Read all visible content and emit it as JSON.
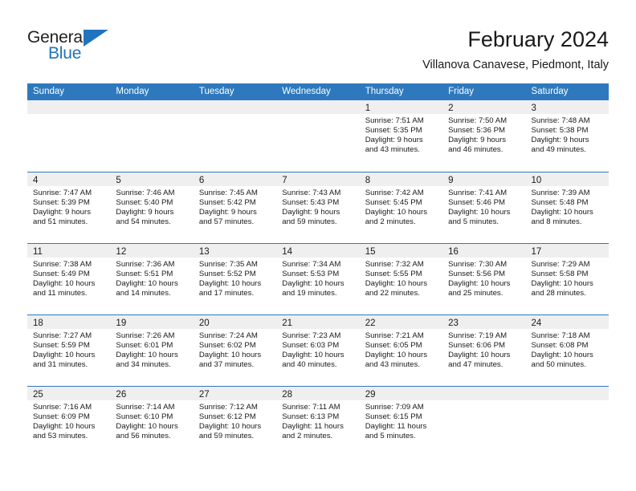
{
  "logo": {
    "word_general": "General",
    "word_blue": "Blue",
    "triangle_color": "#1f74bd"
  },
  "header": {
    "title": "February 2024",
    "subtitle": "Villanova Canavese, Piedmont, Italy"
  },
  "theme": {
    "header_blue": "#2e79bd",
    "strip_gray": "#efefef",
    "text": "#1a1a1a"
  },
  "weekdays": [
    "Sunday",
    "Monday",
    "Tuesday",
    "Wednesday",
    "Thursday",
    "Friday",
    "Saturday"
  ],
  "weeks": [
    [
      {
        "day": "",
        "sunrise": "",
        "sunset": "",
        "daylight1": "",
        "daylight2": "",
        "empty": true
      },
      {
        "day": "",
        "sunrise": "",
        "sunset": "",
        "daylight1": "",
        "daylight2": "",
        "empty": true
      },
      {
        "day": "",
        "sunrise": "",
        "sunset": "",
        "daylight1": "",
        "daylight2": "",
        "empty": true
      },
      {
        "day": "",
        "sunrise": "",
        "sunset": "",
        "daylight1": "",
        "daylight2": "",
        "empty": true
      },
      {
        "day": "1",
        "sunrise": "Sunrise: 7:51 AM",
        "sunset": "Sunset: 5:35 PM",
        "daylight1": "Daylight: 9 hours",
        "daylight2": "and 43 minutes.",
        "empty": false
      },
      {
        "day": "2",
        "sunrise": "Sunrise: 7:50 AM",
        "sunset": "Sunset: 5:36 PM",
        "daylight1": "Daylight: 9 hours",
        "daylight2": "and 46 minutes.",
        "empty": false
      },
      {
        "day": "3",
        "sunrise": "Sunrise: 7:48 AM",
        "sunset": "Sunset: 5:38 PM",
        "daylight1": "Daylight: 9 hours",
        "daylight2": "and 49 minutes.",
        "empty": false
      }
    ],
    [
      {
        "day": "4",
        "sunrise": "Sunrise: 7:47 AM",
        "sunset": "Sunset: 5:39 PM",
        "daylight1": "Daylight: 9 hours",
        "daylight2": "and 51 minutes.",
        "empty": false
      },
      {
        "day": "5",
        "sunrise": "Sunrise: 7:46 AM",
        "sunset": "Sunset: 5:40 PM",
        "daylight1": "Daylight: 9 hours",
        "daylight2": "and 54 minutes.",
        "empty": false
      },
      {
        "day": "6",
        "sunrise": "Sunrise: 7:45 AM",
        "sunset": "Sunset: 5:42 PM",
        "daylight1": "Daylight: 9 hours",
        "daylight2": "and 57 minutes.",
        "empty": false
      },
      {
        "day": "7",
        "sunrise": "Sunrise: 7:43 AM",
        "sunset": "Sunset: 5:43 PM",
        "daylight1": "Daylight: 9 hours",
        "daylight2": "and 59 minutes.",
        "empty": false
      },
      {
        "day": "8",
        "sunrise": "Sunrise: 7:42 AM",
        "sunset": "Sunset: 5:45 PM",
        "daylight1": "Daylight: 10 hours",
        "daylight2": "and 2 minutes.",
        "empty": false
      },
      {
        "day": "9",
        "sunrise": "Sunrise: 7:41 AM",
        "sunset": "Sunset: 5:46 PM",
        "daylight1": "Daylight: 10 hours",
        "daylight2": "and 5 minutes.",
        "empty": false
      },
      {
        "day": "10",
        "sunrise": "Sunrise: 7:39 AM",
        "sunset": "Sunset: 5:48 PM",
        "daylight1": "Daylight: 10 hours",
        "daylight2": "and 8 minutes.",
        "empty": false
      }
    ],
    [
      {
        "day": "11",
        "sunrise": "Sunrise: 7:38 AM",
        "sunset": "Sunset: 5:49 PM",
        "daylight1": "Daylight: 10 hours",
        "daylight2": "and 11 minutes.",
        "empty": false
      },
      {
        "day": "12",
        "sunrise": "Sunrise: 7:36 AM",
        "sunset": "Sunset: 5:51 PM",
        "daylight1": "Daylight: 10 hours",
        "daylight2": "and 14 minutes.",
        "empty": false
      },
      {
        "day": "13",
        "sunrise": "Sunrise: 7:35 AM",
        "sunset": "Sunset: 5:52 PM",
        "daylight1": "Daylight: 10 hours",
        "daylight2": "and 17 minutes.",
        "empty": false
      },
      {
        "day": "14",
        "sunrise": "Sunrise: 7:34 AM",
        "sunset": "Sunset: 5:53 PM",
        "daylight1": "Daylight: 10 hours",
        "daylight2": "and 19 minutes.",
        "empty": false
      },
      {
        "day": "15",
        "sunrise": "Sunrise: 7:32 AM",
        "sunset": "Sunset: 5:55 PM",
        "daylight1": "Daylight: 10 hours",
        "daylight2": "and 22 minutes.",
        "empty": false
      },
      {
        "day": "16",
        "sunrise": "Sunrise: 7:30 AM",
        "sunset": "Sunset: 5:56 PM",
        "daylight1": "Daylight: 10 hours",
        "daylight2": "and 25 minutes.",
        "empty": false
      },
      {
        "day": "17",
        "sunrise": "Sunrise: 7:29 AM",
        "sunset": "Sunset: 5:58 PM",
        "daylight1": "Daylight: 10 hours",
        "daylight2": "and 28 minutes.",
        "empty": false
      }
    ],
    [
      {
        "day": "18",
        "sunrise": "Sunrise: 7:27 AM",
        "sunset": "Sunset: 5:59 PM",
        "daylight1": "Daylight: 10 hours",
        "daylight2": "and 31 minutes.",
        "empty": false
      },
      {
        "day": "19",
        "sunrise": "Sunrise: 7:26 AM",
        "sunset": "Sunset: 6:01 PM",
        "daylight1": "Daylight: 10 hours",
        "daylight2": "and 34 minutes.",
        "empty": false
      },
      {
        "day": "20",
        "sunrise": "Sunrise: 7:24 AM",
        "sunset": "Sunset: 6:02 PM",
        "daylight1": "Daylight: 10 hours",
        "daylight2": "and 37 minutes.",
        "empty": false
      },
      {
        "day": "21",
        "sunrise": "Sunrise: 7:23 AM",
        "sunset": "Sunset: 6:03 PM",
        "daylight1": "Daylight: 10 hours",
        "daylight2": "and 40 minutes.",
        "empty": false
      },
      {
        "day": "22",
        "sunrise": "Sunrise: 7:21 AM",
        "sunset": "Sunset: 6:05 PM",
        "daylight1": "Daylight: 10 hours",
        "daylight2": "and 43 minutes.",
        "empty": false
      },
      {
        "day": "23",
        "sunrise": "Sunrise: 7:19 AM",
        "sunset": "Sunset: 6:06 PM",
        "daylight1": "Daylight: 10 hours",
        "daylight2": "and 47 minutes.",
        "empty": false
      },
      {
        "day": "24",
        "sunrise": "Sunrise: 7:18 AM",
        "sunset": "Sunset: 6:08 PM",
        "daylight1": "Daylight: 10 hours",
        "daylight2": "and 50 minutes.",
        "empty": false
      }
    ],
    [
      {
        "day": "25",
        "sunrise": "Sunrise: 7:16 AM",
        "sunset": "Sunset: 6:09 PM",
        "daylight1": "Daylight: 10 hours",
        "daylight2": "and 53 minutes.",
        "empty": false
      },
      {
        "day": "26",
        "sunrise": "Sunrise: 7:14 AM",
        "sunset": "Sunset: 6:10 PM",
        "daylight1": "Daylight: 10 hours",
        "daylight2": "and 56 minutes.",
        "empty": false
      },
      {
        "day": "27",
        "sunrise": "Sunrise: 7:12 AM",
        "sunset": "Sunset: 6:12 PM",
        "daylight1": "Daylight: 10 hours",
        "daylight2": "and 59 minutes.",
        "empty": false
      },
      {
        "day": "28",
        "sunrise": "Sunrise: 7:11 AM",
        "sunset": "Sunset: 6:13 PM",
        "daylight1": "Daylight: 11 hours",
        "daylight2": "and 2 minutes.",
        "empty": false
      },
      {
        "day": "29",
        "sunrise": "Sunrise: 7:09 AM",
        "sunset": "Sunset: 6:15 PM",
        "daylight1": "Daylight: 11 hours",
        "daylight2": "and 5 minutes.",
        "empty": false
      },
      {
        "day": "",
        "sunrise": "",
        "sunset": "",
        "daylight1": "",
        "daylight2": "",
        "empty": true
      },
      {
        "day": "",
        "sunrise": "",
        "sunset": "",
        "daylight1": "",
        "daylight2": "",
        "empty": true
      }
    ]
  ]
}
